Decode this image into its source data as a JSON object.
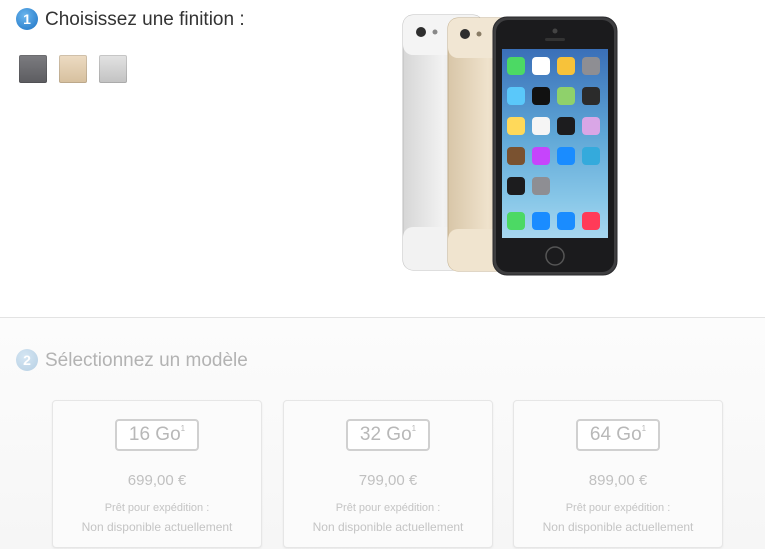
{
  "step1": {
    "number": "1",
    "title": "Choisissez une finition :"
  },
  "finishes": [
    {
      "name": "space-gray",
      "color": "#6b6b6f"
    },
    {
      "name": "gold",
      "color": "#e2cfb1"
    },
    {
      "name": "silver",
      "color": "#d2d2d2"
    }
  ],
  "step2": {
    "number": "2",
    "title": "Sélectionnez un modèle"
  },
  "models": [
    {
      "capacity": "16 Go",
      "footnote": "1",
      "price": "699,00 €",
      "ship_label": "Prêt pour expédition :",
      "ship_status": "Non disponible actuellement"
    },
    {
      "capacity": "32 Go",
      "footnote": "1",
      "price": "799,00 €",
      "ship_label": "Prêt pour expédition :",
      "ship_status": "Non disponible actuellement"
    },
    {
      "capacity": "64 Go",
      "footnote": "1",
      "price": "899,00 €",
      "ship_label": "Prêt pour expédition :",
      "ship_status": "Non disponible actuellement"
    }
  ],
  "app_labels": [
    "Messages",
    "Calendar",
    "Photos",
    "Camera",
    "Weather",
    "Clock",
    "Maps",
    "Videos",
    "Notes",
    "Reminders",
    "Stocks",
    "Game Center",
    "Newsstand",
    "iTunes Store",
    "App Store",
    "Passbook",
    "Compass",
    "Settings",
    "",
    "",
    "Phone",
    "Mail",
    "Safari",
    "Music"
  ]
}
